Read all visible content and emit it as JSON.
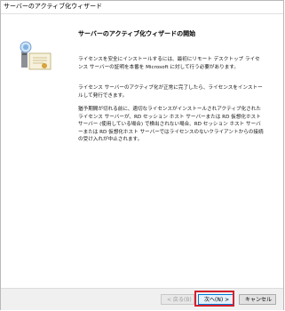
{
  "window": {
    "title": "サーバーのアクティブ化ウィザード"
  },
  "side_panel": {
    "icon": "server-certificate-icon"
  },
  "content": {
    "heading": "サーバーのアクティブ化ウィザードの開始",
    "paragraphs": [
      "ライセンスを安全にインストールするには、最初にリモート デスクトップ ライセンス サーバーの証明を本番を Microsoft に対して行う必要があります。",
      "ライセンス サーバーのアクティブ化が正常に完了したら、ライセンスをインストールして発行できます。",
      "猶予期間が切れる前に、適切なライセンスがインストールされアクティブ化されたライセンス サーバーが、RD セッション ホスト サーバーまたは RD 仮想化ホスト サーバー (使用している場合) で検出されない場合、RD セッション ホスト サーバーまたは RD 仮想化ホスト サーバーではライセンスのないクライアントからの接続の受け入れが中止されます。"
    ]
  },
  "footer": {
    "back_label": "< 戻る(B)",
    "next_label": "次へ(N) >",
    "cancel_label": "キャンセル"
  },
  "colors": {
    "highlight": "#d4202c",
    "primary_button_border": "#0078d7"
  }
}
